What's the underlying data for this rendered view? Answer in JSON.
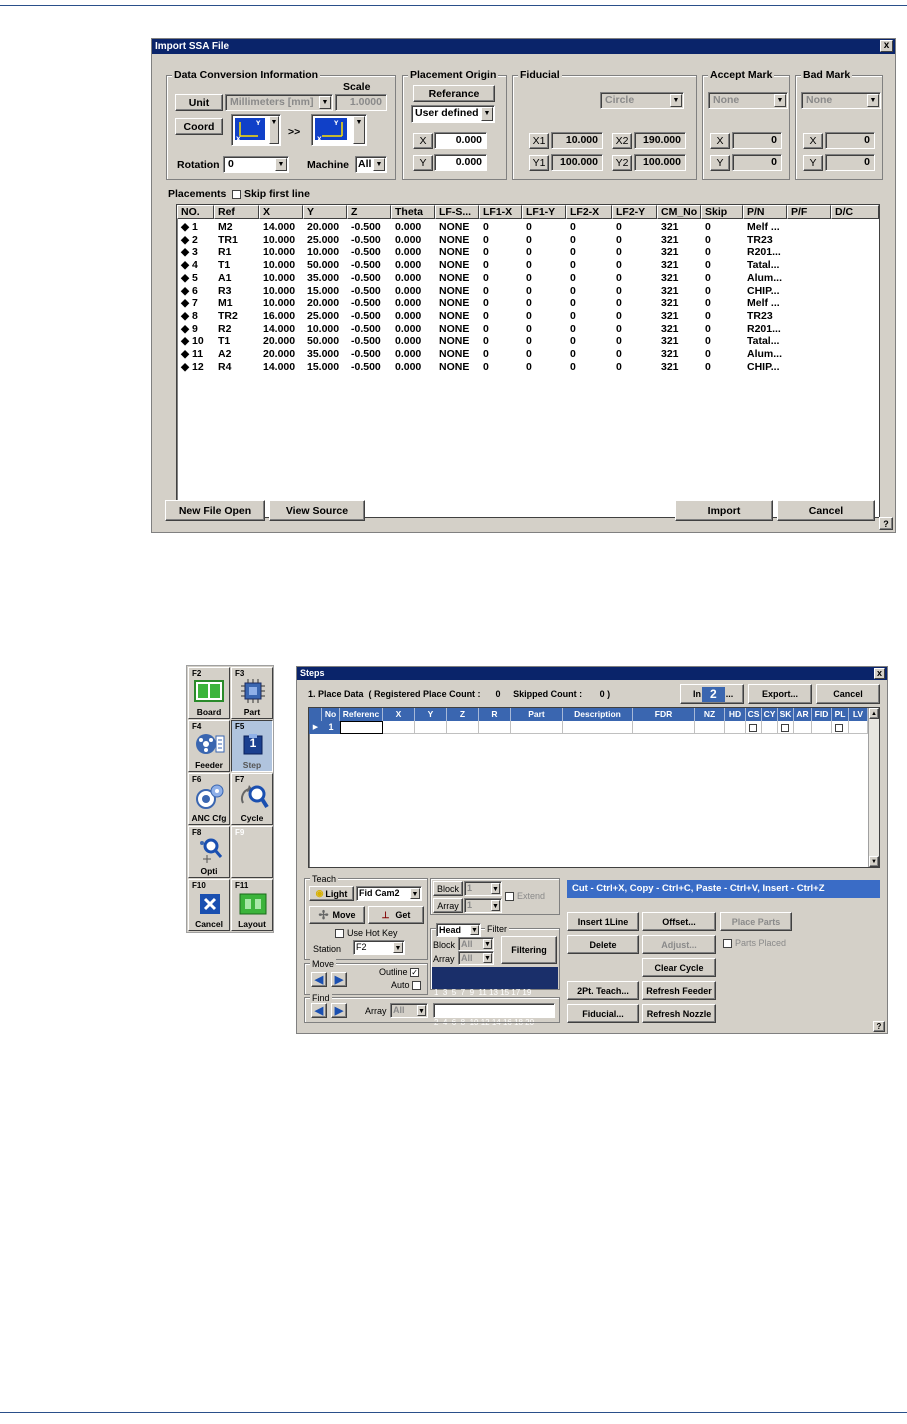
{
  "ssa": {
    "title": "Import SSA File",
    "close": "x",
    "data_conv": {
      "label": "Data Conversion Information",
      "scale_label": "Scale",
      "unit_btn": "Unit",
      "unit_value": "Millimeters [mm]",
      "scale_value": "1.0000",
      "coord_btn": "Coord",
      "arrows": ">>",
      "rotation_label": "Rotation",
      "rotation_value": "0",
      "machine_label": "Machine",
      "machine_value": "All"
    },
    "placement_origin": {
      "label": "Placement Origin",
      "ref_btn": "Referance",
      "mode": "User defined",
      "x_label": "X",
      "x_value": "0.000",
      "y_label": "Y",
      "y_value": "0.000"
    },
    "fiducial": {
      "label": "Fiducial",
      "shape": "Circle",
      "x1_label": "X1",
      "x1": "10.000",
      "x2_label": "X2",
      "x2": "190.000",
      "y1_label": "Y1",
      "y1": "100.000",
      "y2_label": "Y2",
      "y2": "100.000"
    },
    "accept_mark": {
      "label": "Accept Mark",
      "value": "None",
      "x_label": "X",
      "x": "0",
      "y_label": "Y",
      "y": "0"
    },
    "bad_mark": {
      "label": "Bad Mark",
      "value": "None",
      "x_label": "X",
      "x": "0",
      "y_label": "Y",
      "y": "0"
    },
    "placements_label": "Placements",
    "skip_first_line": "Skip first line",
    "columns": [
      "NO.",
      "Ref",
      "X",
      "Y",
      "Z",
      "Theta",
      "LF-S...",
      "LF1-X",
      "LF1-Y",
      "LF2-X",
      "LF2-Y",
      "CM_No",
      "Skip",
      "P/N",
      "P/F",
      "D/C"
    ],
    "rows": [
      [
        "◆ 1",
        "M2",
        "14.000",
        "20.000",
        "-0.500",
        "0.000",
        "NONE",
        "0",
        "0",
        "0",
        "0",
        "321",
        "0",
        "Melf ..."
      ],
      [
        "◆ 2",
        "TR1",
        "10.000",
        "25.000",
        "-0.500",
        "0.000",
        "NONE",
        "0",
        "0",
        "0",
        "0",
        "321",
        "0",
        "TR23"
      ],
      [
        "◆ 3",
        "R1",
        "10.000",
        "10.000",
        "-0.500",
        "0.000",
        "NONE",
        "0",
        "0",
        "0",
        "0",
        "321",
        "0",
        "R201..."
      ],
      [
        "◆ 4",
        "T1",
        "10.000",
        "50.000",
        "-0.500",
        "0.000",
        "NONE",
        "0",
        "0",
        "0",
        "0",
        "321",
        "0",
        "Tatal..."
      ],
      [
        "◆ 5",
        "A1",
        "10.000",
        "35.000",
        "-0.500",
        "0.000",
        "NONE",
        "0",
        "0",
        "0",
        "0",
        "321",
        "0",
        "Alum..."
      ],
      [
        "◆ 6",
        "R3",
        "10.000",
        "15.000",
        "-0.500",
        "0.000",
        "NONE",
        "0",
        "0",
        "0",
        "0",
        "321",
        "0",
        "CHIP..."
      ],
      [
        "◆ 7",
        "M1",
        "10.000",
        "20.000",
        "-0.500",
        "0.000",
        "NONE",
        "0",
        "0",
        "0",
        "0",
        "321",
        "0",
        "Melf ..."
      ],
      [
        "◆ 8",
        "TR2",
        "16.000",
        "25.000",
        "-0.500",
        "0.000",
        "NONE",
        "0",
        "0",
        "0",
        "0",
        "321",
        "0",
        "TR23"
      ],
      [
        "◆ 9",
        "R2",
        "14.000",
        "10.000",
        "-0.500",
        "0.000",
        "NONE",
        "0",
        "0",
        "0",
        "0",
        "321",
        "0",
        "R201..."
      ],
      [
        "◆ 10",
        "T1",
        "20.000",
        "50.000",
        "-0.500",
        "0.000",
        "NONE",
        "0",
        "0",
        "0",
        "0",
        "321",
        "0",
        "Tatal..."
      ],
      [
        "◆ 11",
        "A2",
        "20.000",
        "35.000",
        "-0.500",
        "0.000",
        "NONE",
        "0",
        "0",
        "0",
        "0",
        "321",
        "0",
        "Alum..."
      ],
      [
        "◆ 12",
        "R4",
        "14.000",
        "15.000",
        "-0.500",
        "0.000",
        "NONE",
        "0",
        "0",
        "0",
        "0",
        "321",
        "0",
        "CHIP..."
      ]
    ],
    "buttons": {
      "new_file": "New File Open",
      "view_source": "View Source",
      "import": "Import",
      "cancel": "Cancel",
      "help": "?"
    }
  },
  "side": [
    {
      "key": "F2",
      "label": "Board"
    },
    {
      "key": "F3",
      "label": "Part"
    },
    {
      "key": "F4",
      "label": "Feeder"
    },
    {
      "key": "F5",
      "label": "Step",
      "badge": "1"
    },
    {
      "key": "F6",
      "label": "ANC Cfg"
    },
    {
      "key": "F7",
      "label": "Cycle"
    },
    {
      "key": "F8",
      "label": "Opti"
    },
    {
      "key": "F9",
      "label": ""
    },
    {
      "key": "F10",
      "label": "Cancel"
    },
    {
      "key": "F11",
      "label": "Layout"
    }
  ],
  "steps": {
    "title": "Steps",
    "close": "x",
    "info": "1. Place Data  ( Registered Place Count :      0     Skipped Count :       0 )",
    "import_btn_left": "In",
    "import_btn_right": "...",
    "badge": "2",
    "export_btn": "Export...",
    "cancel_btn": "Cancel",
    "columns": [
      "No",
      "Referenc",
      "X",
      "Y",
      "Z",
      "R",
      "Part",
      "Description",
      "FDR",
      "NZ",
      "HD",
      "CS",
      "CY",
      "SK",
      "AR",
      "FID",
      "PL",
      "LV"
    ],
    "first_row_no": "1",
    "teach_label": "Teach",
    "light_btn": "Light",
    "camera": "Fid Cam2",
    "move_btn": "Move",
    "get_btn": "Get",
    "use_hot_key": "Use Hot Key",
    "station_label": "Station",
    "station_value": "F2",
    "move_label": "Move",
    "outline_label": "Outline",
    "auto_label": "Auto",
    "block_label": "Block",
    "block_value": "1",
    "array_label": "Array",
    "array_value": "1",
    "extend_label": "Extend",
    "head_value": "Head",
    "filter_label": "Filter",
    "filter_block_label": "Block",
    "filter_block_value": "All",
    "filter_array_label": "Array",
    "filter_array_value": "All",
    "filtering_btn": "Filtering",
    "heads_top": "1  3  5  7  9  11 13 15 17 19",
    "heads_bottom": "2  4  6  8  10 12 14 16 18 20",
    "find_label": "Find",
    "find_array_label": "Array",
    "find_array_value": "All",
    "shortcut_banner": "Cut - Ctrl+X,  Copy - Ctrl+C,  Paste - Ctrl+V,  Insert - Ctrl+Z",
    "insert_line_btn": "Insert 1Line",
    "offset_btn": "Offset...",
    "place_parts_btn": "Place Parts",
    "delete_btn": "Delete",
    "adjust_btn": "Adjust...",
    "parts_placed": "Parts Placed",
    "clear_cycle_btn": "Clear Cycle",
    "teach2pt_btn": "2Pt. Teach...",
    "refresh_feeder_btn": "Refresh Feeder",
    "fiducial_btn": "Fiducial...",
    "refresh_nozzle_btn": "Refresh Nozzle",
    "help": "?"
  },
  "colors": {
    "titlebar": "#0a246a",
    "face": "#d4d0c8",
    "grid_header": "#3a66b0",
    "banner": "#3a6cc6",
    "rule": "#2a4f8a"
  }
}
